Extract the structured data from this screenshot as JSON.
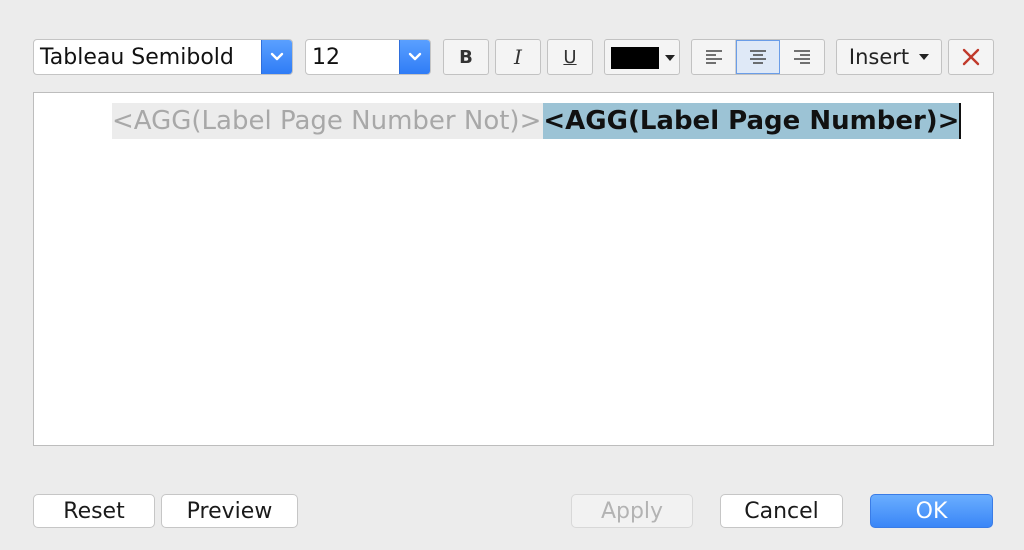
{
  "toolbar": {
    "font_family": "Tableau Semibold",
    "font_size": "12",
    "bold_label": "B",
    "italic_label": "I",
    "underline_label": "U",
    "text_color": "#000000",
    "align_active": "center",
    "insert_label": "Insert",
    "clear_icon": "x-icon"
  },
  "editor": {
    "segment_inactive": "<AGG(Label Page Number Not)>",
    "segment_selected": "<AGG(Label Page Number)>"
  },
  "buttons": {
    "reset": "Reset",
    "preview": "Preview",
    "apply": "Apply",
    "cancel": "Cancel",
    "ok": "OK"
  },
  "colors": {
    "accent": "#3a86f7",
    "selection": "#9cc3d5",
    "clear_icon": "#c0392b"
  }
}
